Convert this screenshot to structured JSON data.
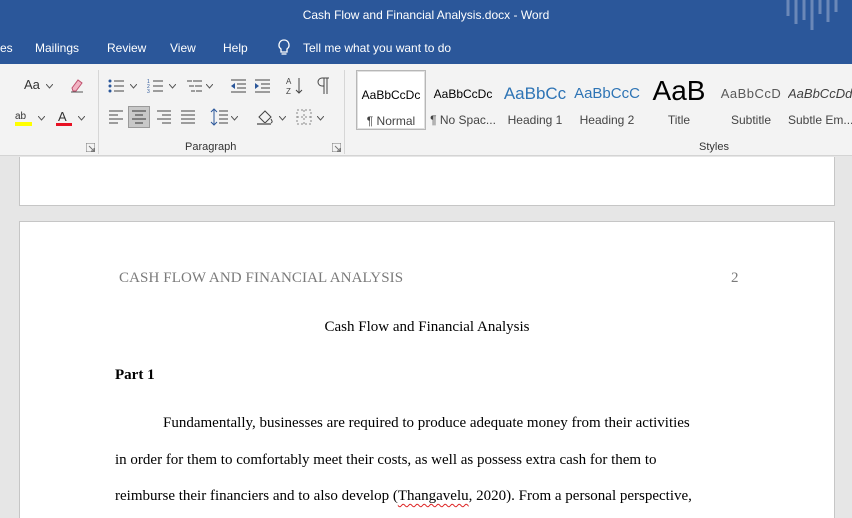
{
  "window": {
    "title": "Cash Flow and Financial Analysis.docx  -  Word"
  },
  "menu": {
    "items": [
      "es",
      "Mailings",
      "Review",
      "View",
      "Help"
    ],
    "tell_me": "Tell me what you want to do"
  },
  "ribbon": {
    "font_size_glyph": "Aa",
    "paragraph_label": "Paragraph",
    "styles_label": "Styles",
    "styles": [
      {
        "sample": "AaBbCcDc",
        "name": "¶ Normal"
      },
      {
        "sample": "AaBbCcDc",
        "name": "¶ No Spac..."
      },
      {
        "sample": "AaBbCc",
        "name": "Heading 1"
      },
      {
        "sample": "AaBbCcC",
        "name": "Heading 2"
      },
      {
        "sample": "AaB",
        "name": "Title"
      },
      {
        "sample": "AaBbCcD",
        "name": "Subtitle"
      },
      {
        "sample": "AaBbCcDd",
        "name": "Subtle Em..."
      }
    ],
    "colors": {
      "highlight": "#ffff00",
      "font_color": "#e81123"
    }
  },
  "document": {
    "running_head": "CASH FLOW AND FINANCIAL ANALYSIS",
    "page_number": "2",
    "title": "Cash Flow and Financial Analysis",
    "heading": "Part 1",
    "lines": [
      "Fundamentally, businesses are required to produce adequate money from their activities",
      "in order for them to comfortably meet their costs, as well as possess extra cash for them to",
      "reimburse their financiers and to also develop ("
    ],
    "citation_author": "Thangavelu",
    "citation_rest": ", 2020). From a personal perspective,"
  }
}
